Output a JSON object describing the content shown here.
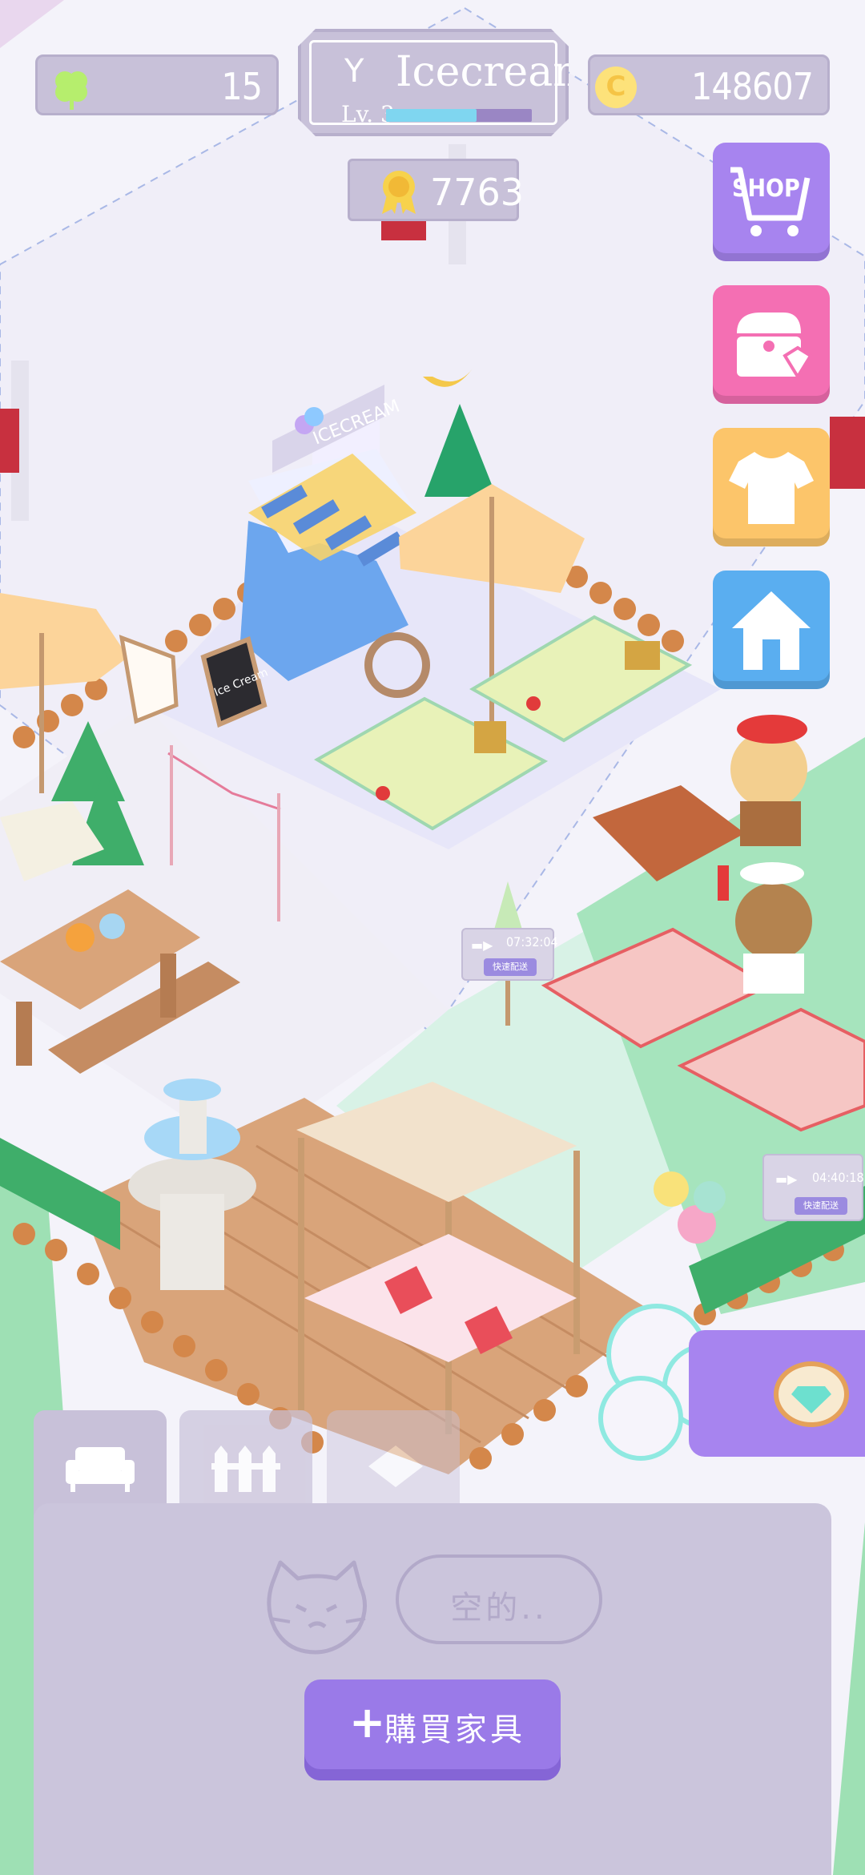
{
  "hud": {
    "clovers": "15",
    "shop_name": "Icecream",
    "shop_initial": "Y",
    "level": "Lv. 3",
    "xp_progress": 0.62,
    "coins": "148607",
    "coin_symbol": "C",
    "trophies": "7763"
  },
  "side_buttons": {
    "shop_label": "SHOP"
  },
  "scene": {
    "sign_ice_cart": "ICECREAM",
    "chalkboard_text": "Ice Cream",
    "timer_1": "07:32:04",
    "timer_1_button": "快速配送",
    "timer_2": "04:40:18",
    "timer_2_button": "快速配送"
  },
  "inventory": {
    "empty_text": "空的..",
    "buy_label": "購買家具",
    "buy_icon": "+"
  },
  "colors": {
    "panel": "#cbc5dc",
    "accent_purple": "#a784ef",
    "shop_pink": "#f46fb3",
    "outfit_yellow": "#fcc56a",
    "home_blue": "#5aaef0"
  }
}
